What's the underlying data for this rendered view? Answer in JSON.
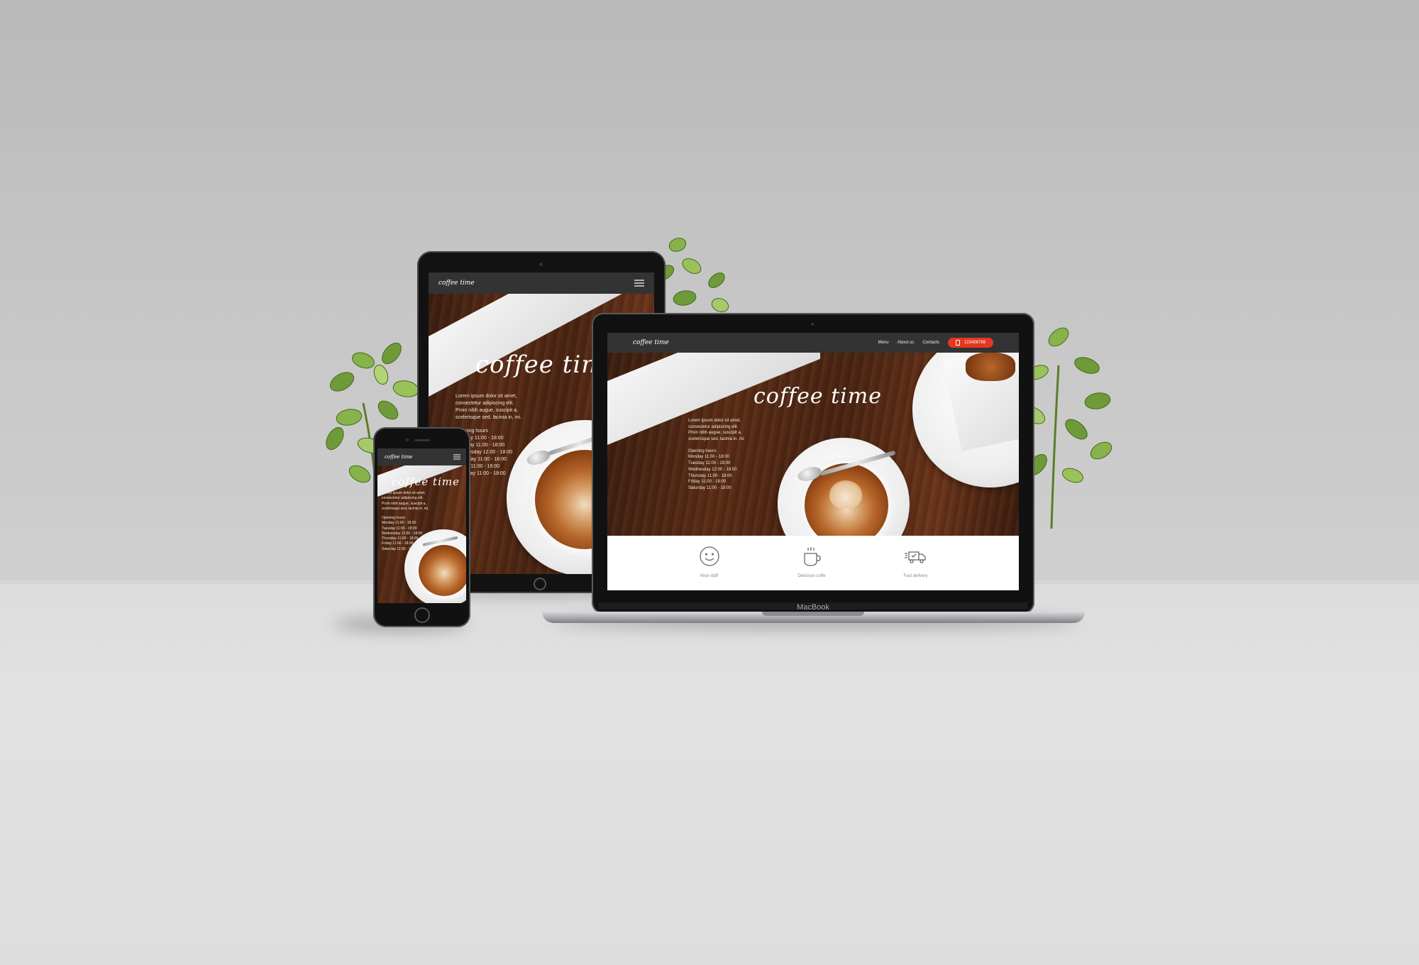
{
  "scene": {
    "wall_color": "#c2c2c2",
    "floor_color": "#dfdfdf",
    "laptop_brand": "MacBook"
  },
  "site": {
    "logo": "coffee time",
    "nav": {
      "menu": "Menu",
      "about": "About us",
      "contacts": "Contacts",
      "phone": "123456789"
    },
    "hero_title": "coffee time",
    "intro": [
      "Lorem ipsum dolor sit amet,",
      "consectetur adipiscing elit.",
      "Proin nibh augue, suscipit a,",
      "scelerisque sed, lacinia in, mi."
    ],
    "hours_title": "Opening hours",
    "hours": [
      "Monday 11:00 - 18:00",
      "Tuesday 11:00 - 18:00",
      "Wednesday 12:00 - 18:00",
      "Thursday 11:00 - 18:00",
      "Friday 11:00 - 18:00",
      "Saturday 11:00 - 18:00"
    ],
    "features": [
      {
        "icon": "smiley-icon",
        "label": "Nice staff"
      },
      {
        "icon": "coffee-cup-icon",
        "label": "Delicious coffe"
      },
      {
        "icon": "delivery-truck-icon",
        "label": "Fast delivery"
      }
    ],
    "accent": "#e5371f"
  }
}
